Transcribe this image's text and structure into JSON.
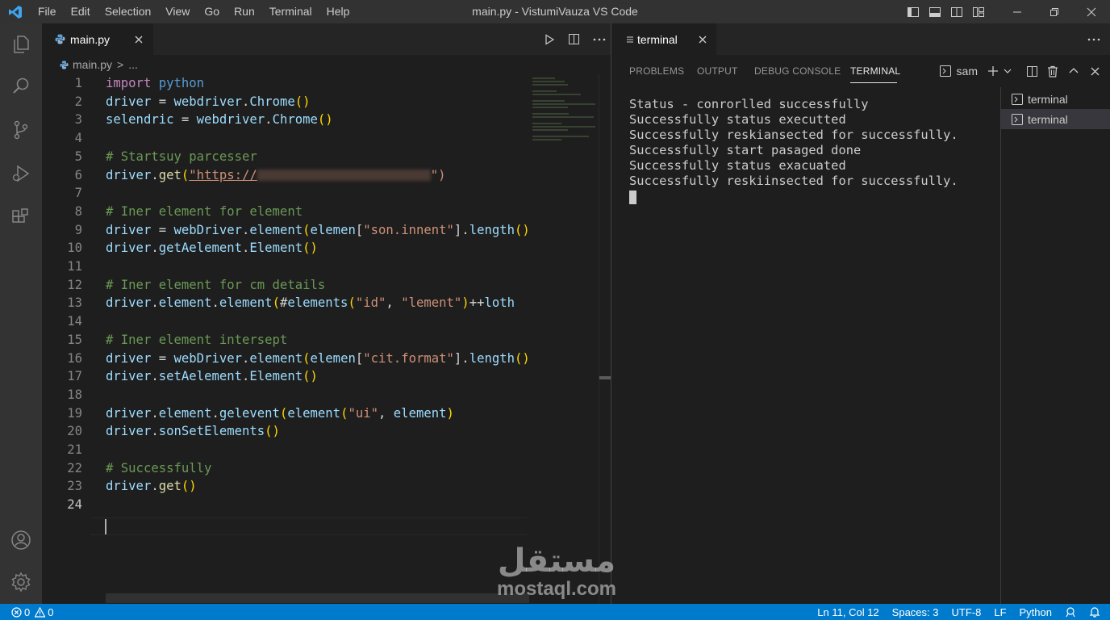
{
  "titlebar": {
    "menu": [
      "File",
      "Edit",
      "Selection",
      "View",
      "Go",
      "Run",
      "Terminal",
      "Help"
    ],
    "title": "main.py - VistumiVauza VS Code",
    "icons": [
      "vscode-logo-icon",
      "toggle-sidebar-icon",
      "toggle-panel-icon",
      "toggle-secondary-sidebar-icon",
      "customize-layout-icon",
      "minimize-icon",
      "restore-icon",
      "close-icon"
    ]
  },
  "activitybar": {
    "items": [
      "explorer-icon",
      "search-icon",
      "source-control-icon",
      "run-debug-icon",
      "extensions-icon",
      "account-icon",
      "manage-gear-icon"
    ]
  },
  "editor": {
    "tab_label": "main.py",
    "breadcrumb": {
      "file": "main.py",
      "sep": ">",
      "more": "..."
    },
    "active_line": 24,
    "lines": [
      {
        "n": "1",
        "t": "import python"
      },
      {
        "n": "2",
        "t": "driver = webdriver.Chrome()"
      },
      {
        "n": "3",
        "t": "selendric = webdriver.Chrome()"
      },
      {
        "n": "4",
        "t": ""
      },
      {
        "n": "5",
        "t": "# Startsuy parcesser"
      },
      {
        "n": "6",
        "t": "driver.get(\"https://"
      },
      {
        "n": "7",
        "t": ""
      },
      {
        "n": "8",
        "t": "# Iner element for element"
      },
      {
        "n": "9",
        "t": "driver = webDriver.element(elemen[\"son.innent\"].length()"
      },
      {
        "n": "10",
        "t": "driver.getAelement.Element()"
      },
      {
        "n": "11",
        "t": ""
      },
      {
        "n": "12",
        "t": "# Iner element for cm details"
      },
      {
        "n": "13",
        "t": "driver.element.element(#elements(\"id\", \"lement\")++loth"
      },
      {
        "n": "14",
        "t": ""
      },
      {
        "n": "15",
        "t": "# Iner element intersept"
      },
      {
        "n": "16",
        "t": "driver = webDriver.element(elemen[\"cit.format\"].length()"
      },
      {
        "n": "17",
        "t": "driver.setAelement.Element()"
      },
      {
        "n": "18",
        "t": ""
      },
      {
        "n": "19",
        "t": "driver.element.gelevent(element(\"ui\", element)"
      },
      {
        "n": "20",
        "t": "driver.sonSetElements()"
      },
      {
        "n": "21",
        "t": ""
      },
      {
        "n": "22",
        "t": "# Successfully"
      },
      {
        "n": "23",
        "t": "driver.get()"
      },
      {
        "n": "24",
        "t": ""
      }
    ]
  },
  "right_editor": {
    "tab_label": "terminal",
    "more": "···"
  },
  "panel": {
    "tabs": [
      "PROBLEMS",
      "OUTPUT",
      "DEBUG CONSOLE",
      "TERMINAL"
    ],
    "active_tab": "TERMINAL",
    "terminal_selector": "sam",
    "output": [
      "Status - conrorlled successfully",
      "Successfully status executted",
      "Successfully reskiansected for successfully.",
      "Successfully start pasaged done",
      "Successfully status exacuated",
      "Successfully reskiinsected for successfully."
    ],
    "terminal_list": [
      "terminal",
      "terminal"
    ],
    "selected_terminal": 1
  },
  "statusbar": {
    "errors": "0",
    "warnings": "0",
    "position": "Ln 11, Col 12",
    "spaces": "Spaces: 3",
    "encoding": "UTF-8",
    "eol": "LF",
    "language": "Python"
  },
  "watermark": {
    "arabic": "مستقل",
    "latin": "mostaql.com"
  },
  "colors": {
    "accent": "#007acc",
    "titlebar": "#323233",
    "activitybar": "#333333",
    "editor_bg": "#1e1e1e"
  }
}
